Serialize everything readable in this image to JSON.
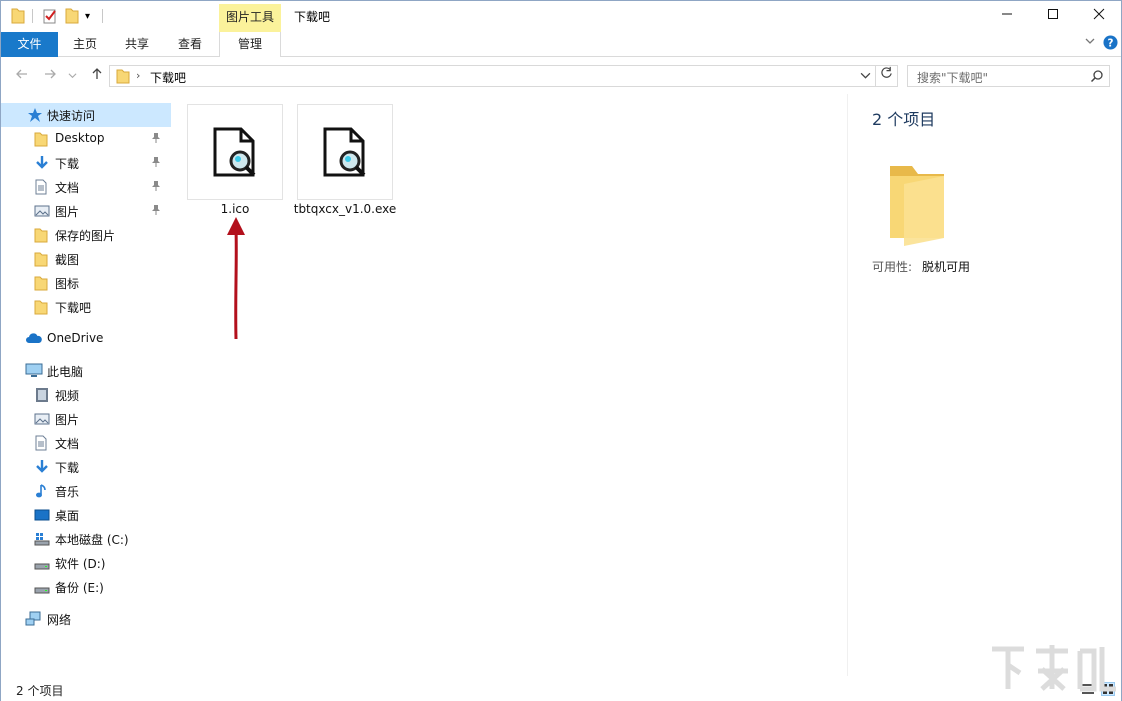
{
  "window": {
    "title": "下载吧",
    "contextual_tab_group": "图片工具",
    "controls": [
      "minimize",
      "maximize",
      "close"
    ]
  },
  "ribbon": {
    "tabs": [
      {
        "label": "文件"
      },
      {
        "label": "主页"
      },
      {
        "label": "共享"
      },
      {
        "label": "查看"
      },
      {
        "label": "管理"
      }
    ]
  },
  "address": {
    "path": "下载吧",
    "search_placeholder": "搜索\"下载吧\""
  },
  "sidebar": {
    "quick_access": "快速访问",
    "quick_items": [
      {
        "label": "Desktop",
        "icon": "folder-icon",
        "pinned": true
      },
      {
        "label": "下载",
        "icon": "download-icon",
        "pinned": true
      },
      {
        "label": "文档",
        "icon": "document-icon",
        "pinned": true
      },
      {
        "label": "图片",
        "icon": "pictures-icon",
        "pinned": true
      },
      {
        "label": "保存的图片",
        "icon": "folder-icon",
        "pinned": false
      },
      {
        "label": "截图",
        "icon": "folder-icon",
        "pinned": false
      },
      {
        "label": "图标",
        "icon": "folder-icon",
        "pinned": false
      },
      {
        "label": "下载吧",
        "icon": "folder-icon",
        "pinned": false
      }
    ],
    "onedrive": "OneDrive",
    "this_pc": "此电脑",
    "pc_items": [
      {
        "label": "视频",
        "icon": "video-icon"
      },
      {
        "label": "图片",
        "icon": "pictures-icon"
      },
      {
        "label": "文档",
        "icon": "document-icon"
      },
      {
        "label": "下载",
        "icon": "download-icon"
      },
      {
        "label": "音乐",
        "icon": "music-icon"
      },
      {
        "label": "桌面",
        "icon": "desktop-icon"
      },
      {
        "label": "本地磁盘 (C:)",
        "icon": "system-drive-icon"
      },
      {
        "label": "软件 (D:)",
        "icon": "drive-icon"
      },
      {
        "label": "备份 (E:)",
        "icon": "drive-icon"
      }
    ],
    "network": "网络"
  },
  "files": [
    {
      "name": "1.ico",
      "icon": "ico-file-icon"
    },
    {
      "name": "tbtqxcx_v1.0.exe",
      "icon": "exe-file-icon"
    }
  ],
  "details": {
    "count": "2 个项目",
    "availability_label": "可用性:",
    "availability_value": "脱机可用"
  },
  "status": {
    "text": "2 个项目"
  },
  "colors": {
    "file_tab": "#1979ca",
    "context_tab": "#fbf29b",
    "selection": "#cce8ff",
    "folder": "#f8d775",
    "arrow": "#b3101c"
  }
}
